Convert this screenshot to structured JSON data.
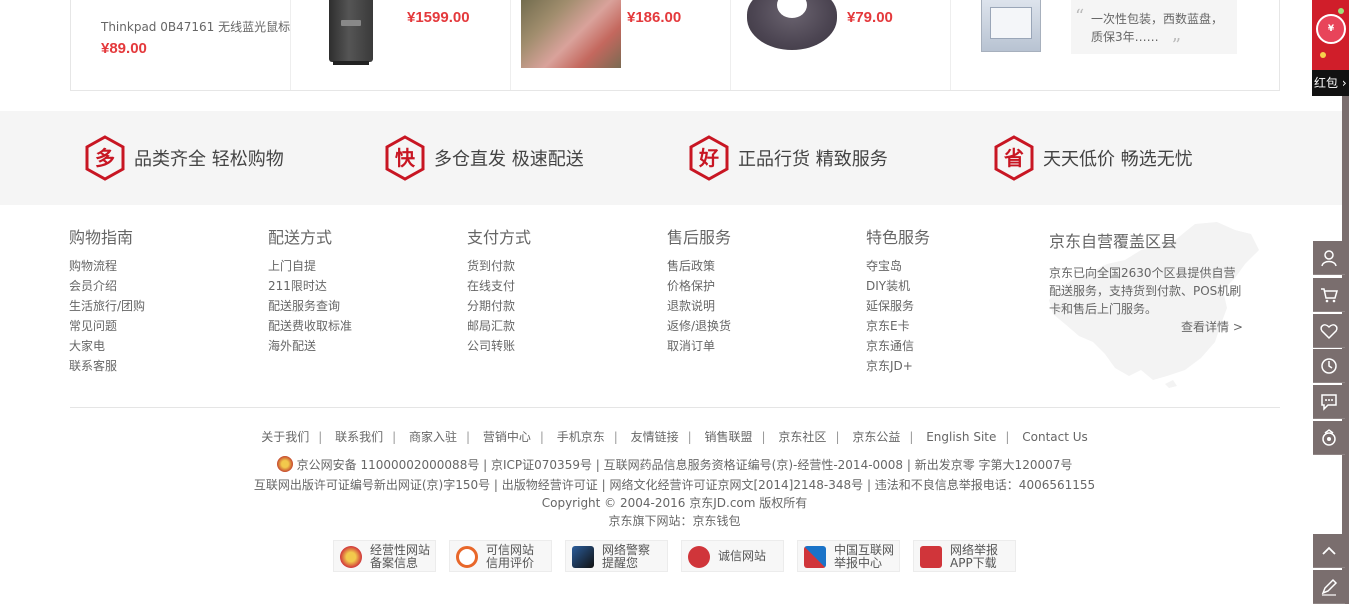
{
  "products": [
    {
      "name": "Thinkpad 0B47161 无线蓝光鼠标（",
      "price": "¥89.00"
    },
    {
      "price": "¥1599.00",
      "image": "printer"
    },
    {
      "price": "¥186.00",
      "image": "dress-photo"
    },
    {
      "price": "¥79.00",
      "image": "neck-pillow"
    },
    {
      "image": "hard-disk",
      "quote": "一次性包装，西数蓝盘，质保3年……"
    }
  ],
  "services": [
    {
      "icon": "多",
      "text": "品类齐全  轻松购物"
    },
    {
      "icon": "快",
      "text": "多仓直发  极速配送"
    },
    {
      "icon": "好",
      "text": "正品行货  精致服务"
    },
    {
      "icon": "省",
      "text": "天天低价  畅选无忧"
    }
  ],
  "help_columns": [
    {
      "title": "购物指南",
      "items": [
        "购物流程",
        "会员介绍",
        "生活旅行/团购",
        "常见问题",
        "大家电",
        "联系客服"
      ]
    },
    {
      "title": "配送方式",
      "items": [
        "上门自提",
        "211限时达",
        "配送服务查询",
        "配送费收取标准",
        "海外配送"
      ]
    },
    {
      "title": "支付方式",
      "items": [
        "货到付款",
        "在线支付",
        "分期付款",
        "邮局汇款",
        "公司转账"
      ]
    },
    {
      "title": "售后服务",
      "items": [
        "售后政策",
        "价格保护",
        "退款说明",
        "返修/退换货",
        "取消订单"
      ]
    },
    {
      "title": "特色服务",
      "items": [
        "夺宝岛",
        "DIY装机",
        "延保服务",
        "京东E卡",
        "京东通信",
        "京东JD+"
      ]
    }
  ],
  "coverage": {
    "title": "京东自营覆盖区县",
    "desc": "京东已向全国2630个区县提供自营配送服务，支持货到付款、POS机刷卡和售后上门服务。",
    "more": "查看详情 >"
  },
  "footer_links": [
    "关于我们",
    "联系我们",
    "商家入驻",
    "营销中心",
    "手机京东",
    "友情链接",
    "销售联盟",
    "京东社区",
    "京东公益",
    "English Site",
    "Contact Us"
  ],
  "copyright": {
    "line1": "京公网安备 11000002000088号 | 京ICP证070359号 | 互联网药品信息服务资格证编号(京)-经营性-2014-0008 | 新出发京零 字第大120007号",
    "line2": "互联网出版许可证编号新出网证(京)字150号 | 出版物经营许可证 | 网络文化经营许可证京网文[2014]2148-348号 | 违法和不良信息举报电话：4006561155",
    "line3": "Copyright © 2004-2016  京东JD.com 版权所有",
    "line4": "京东旗下网站：京东钱包"
  },
  "badges": [
    {
      "l1": "经营性网站",
      "l2": "备案信息",
      "color": "#d0353a"
    },
    {
      "l1": "可信网站",
      "l2": "信用评价",
      "color": "#e8672a"
    },
    {
      "l1": "网络警察",
      "l2": "提醒您",
      "color": "#2b5d9b"
    },
    {
      "l1": "诚信网站",
      "l2": "",
      "color": "#d0353a"
    },
    {
      "l1": "中国互联网",
      "l2": "举报中心",
      "color": "#1a73c8"
    },
    {
      "l1": "网络举报",
      "l2": "APP下载",
      "color": "#d0353a"
    }
  ],
  "toolbar": {
    "redpack_label": "红包",
    "buttons": [
      "user-icon",
      "cart-icon",
      "heart-icon",
      "history-icon",
      "message-icon",
      "service-icon"
    ],
    "bottom_buttons": [
      "top-arrow-icon",
      "feedback-icon"
    ]
  },
  "colors": {
    "accent": "#c81623",
    "price": "#e4393c",
    "toolbar": "#7a6e6e"
  }
}
